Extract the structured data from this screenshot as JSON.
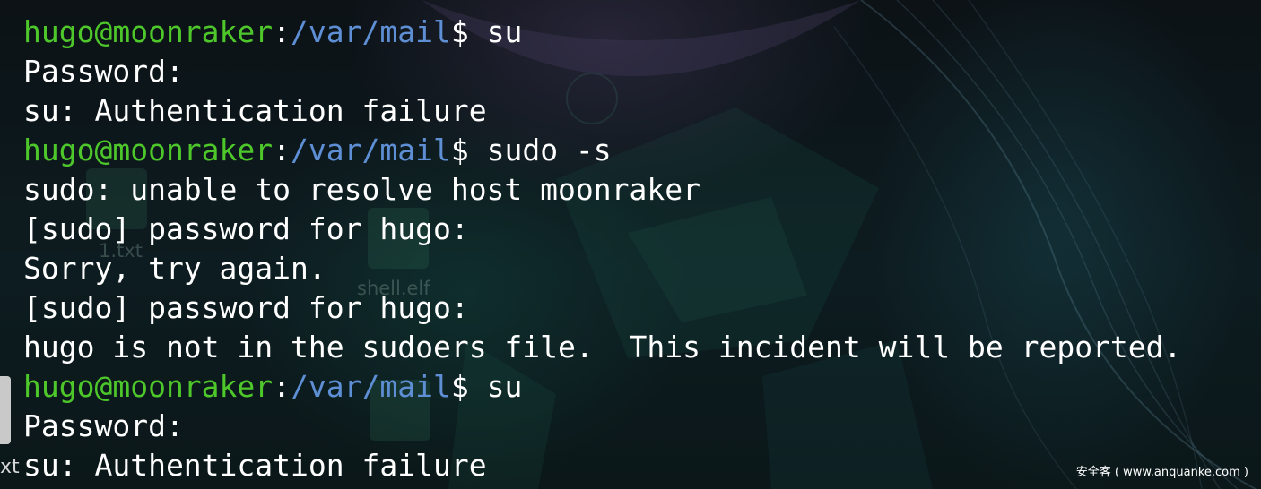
{
  "desktop": {
    "icons": [
      {
        "label": "1.txt"
      },
      {
        "label": "shell.elf"
      }
    ],
    "side_label": "xt"
  },
  "terminal": {
    "lines": [
      {
        "kind": "prompt",
        "user": "hugo@moonraker",
        "colon": ":",
        "path": "/var/mail",
        "sigil": "$",
        "command": " su"
      },
      {
        "kind": "output",
        "text": "Password:"
      },
      {
        "kind": "output",
        "text": "su: Authentication failure"
      },
      {
        "kind": "prompt",
        "user": "hugo@moonraker",
        "colon": ":",
        "path": "/var/mail",
        "sigil": "$",
        "command": " sudo -s"
      },
      {
        "kind": "output",
        "text": "sudo: unable to resolve host moonraker"
      },
      {
        "kind": "output",
        "text": "[sudo] password for hugo:"
      },
      {
        "kind": "output",
        "text": "Sorry, try again."
      },
      {
        "kind": "output",
        "text": "[sudo] password for hugo:"
      },
      {
        "kind": "output",
        "text": "hugo is not in the sudoers file.  This incident will be reported."
      },
      {
        "kind": "prompt",
        "user": "hugo@moonraker",
        "colon": ":",
        "path": "/var/mail",
        "sigil": "$",
        "command": " su"
      },
      {
        "kind": "output",
        "text": "Password:"
      },
      {
        "kind": "output",
        "text": "su: Authentication failure"
      }
    ]
  },
  "watermark": "安全客 ( www.anquanke.com )",
  "colors": {
    "prompt_user": "#4ec72b",
    "prompt_path": "#5e8ed4",
    "text": "#ffffff"
  }
}
